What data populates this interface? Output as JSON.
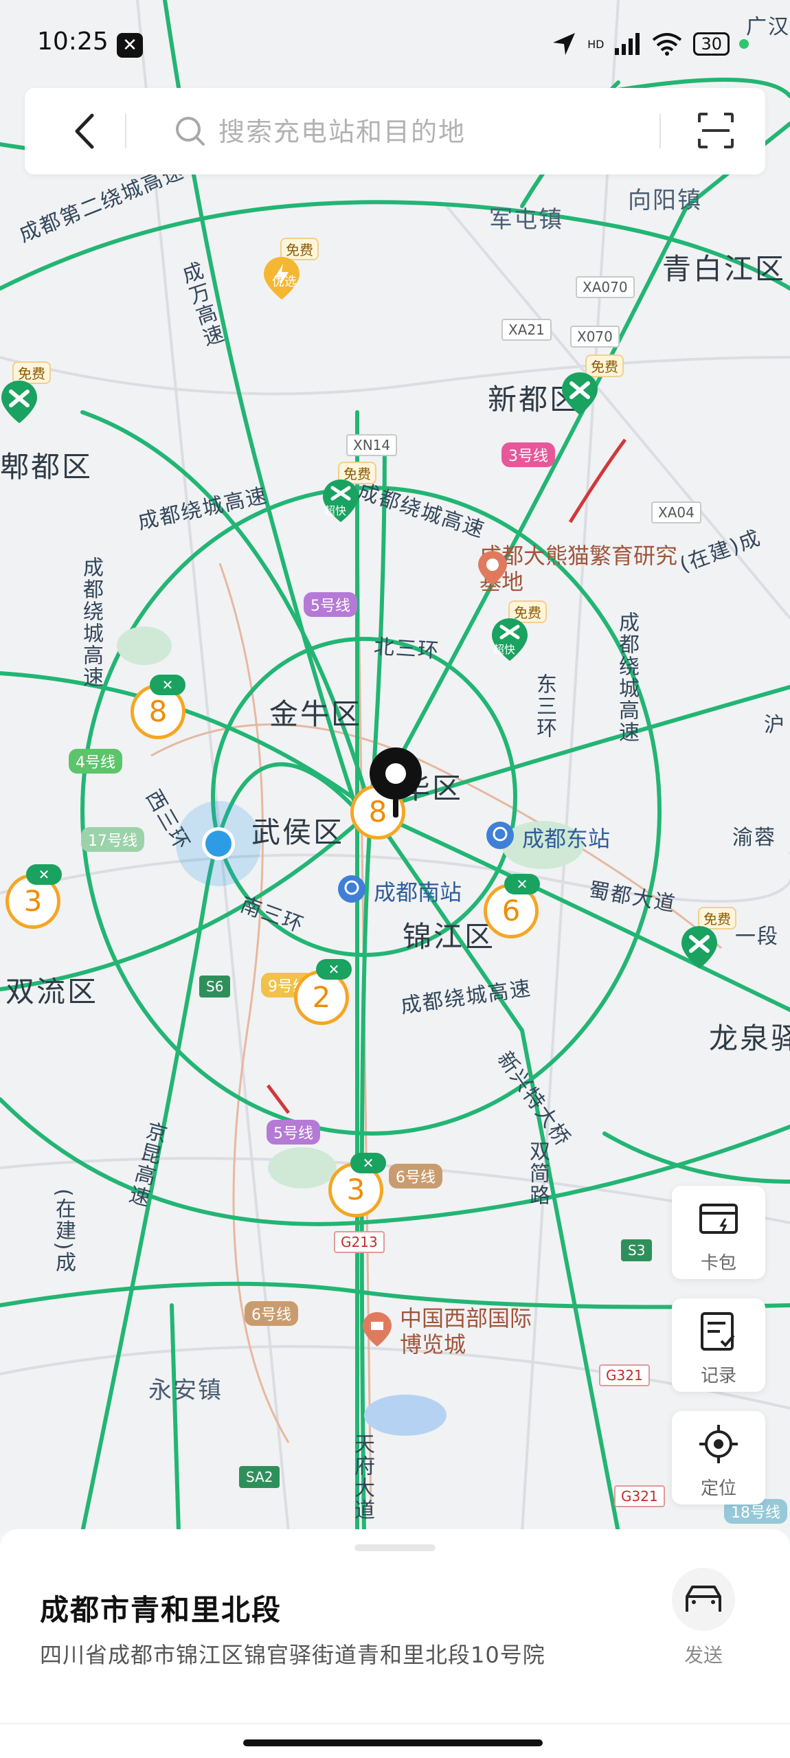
{
  "status_bar": {
    "time": "10:25",
    "app_icon_glyph": "✕",
    "signal_hd": "HD",
    "battery": "30"
  },
  "search": {
    "placeholder": "搜索充电站和目的地"
  },
  "map": {
    "districts": [
      {
        "id": "qingbaijiang",
        "text": "青白江区"
      },
      {
        "id": "xindu",
        "text": "新都区"
      },
      {
        "id": "jinniu",
        "text": "金牛区"
      },
      {
        "id": "wuhou",
        "text": "武侯区"
      },
      {
        "id": "jinjiang",
        "text": "锦江区"
      },
      {
        "id": "shuangliu",
        "text": "双流区"
      },
      {
        "id": "longquan",
        "text": "龙泉驿"
      },
      {
        "id": "pixian",
        "text": "郫都区"
      },
      {
        "id": "chenghua",
        "text": "华区"
      }
    ],
    "towns": [
      {
        "id": "juntun",
        "text": "军屯镇"
      },
      {
        "id": "xiangyang",
        "text": "向阳镇"
      },
      {
        "id": "yongan",
        "text": "永安镇"
      }
    ],
    "roads": [
      {
        "id": "r1",
        "text": "成都第二绕城高速"
      },
      {
        "id": "r2",
        "text": "成都绕城高速"
      },
      {
        "id": "r3",
        "text": "成都绕城高速"
      },
      {
        "id": "r4",
        "text": "成都绕城高速"
      },
      {
        "id": "r5",
        "text": "成都绕城高速"
      },
      {
        "id": "r6",
        "text": "北三环"
      },
      {
        "id": "r7",
        "text": "东三环"
      },
      {
        "id": "r8",
        "text": "南三环"
      },
      {
        "id": "r9",
        "text": "西三环"
      },
      {
        "id": "r10",
        "text": "成都绕城高速"
      },
      {
        "id": "r11",
        "text": "成都绕城高速"
      },
      {
        "id": "r12",
        "text": "蜀都大道"
      },
      {
        "id": "r13",
        "text": "新兴特大桥"
      },
      {
        "id": "r14",
        "text": "双简路"
      },
      {
        "id": "r15",
        "text": "京昆高速"
      },
      {
        "id": "r16",
        "text": "天府大道"
      },
      {
        "id": "r17",
        "text": "成万高速"
      },
      {
        "id": "r18",
        "text": "(在建)成"
      },
      {
        "id": "r19",
        "text": "(在建)成"
      },
      {
        "id": "r20",
        "text": "渝蓉"
      },
      {
        "id": "r21",
        "text": "一段"
      },
      {
        "id": "r22",
        "text": "广汉"
      },
      {
        "id": "r23",
        "text": "沪"
      }
    ],
    "pois": [
      {
        "id": "panda",
        "text": "成都大熊猫繁育研究基地"
      },
      {
        "id": "expo",
        "text": "中国西部国际博览城"
      }
    ],
    "stations": [
      {
        "id": "east",
        "text": "成都东站"
      },
      {
        "id": "south",
        "text": "成都南站"
      }
    ],
    "shields": [
      {
        "id": "xa070",
        "text": "XA070"
      },
      {
        "id": "xa21",
        "text": "XA21"
      },
      {
        "id": "x070",
        "text": "X070"
      },
      {
        "id": "xn14",
        "text": "XN14"
      },
      {
        "id": "xa04",
        "text": "XA04"
      },
      {
        "id": "s6",
        "text": "S6"
      },
      {
        "id": "s3",
        "text": "S3"
      },
      {
        "id": "g213",
        "text": "G213"
      },
      {
        "id": "g321a",
        "text": "G321"
      },
      {
        "id": "g321b",
        "text": "G321"
      },
      {
        "id": "sa2",
        "text": "SA2"
      }
    ],
    "metro_lines": [
      {
        "id": "m3",
        "text": "3号线"
      },
      {
        "id": "m5a",
        "text": "5号线"
      },
      {
        "id": "m4",
        "text": "4号线"
      },
      {
        "id": "m17",
        "text": "17号线"
      },
      {
        "id": "m9",
        "text": "9号线"
      },
      {
        "id": "m5b",
        "text": "5号线"
      },
      {
        "id": "m6a",
        "text": "6号线"
      },
      {
        "id": "m6b",
        "text": "6号线"
      },
      {
        "id": "m18",
        "text": "18号线"
      }
    ],
    "free_tag": "免费",
    "youxuan_tag": "优选",
    "chaokuai_tag": "超快",
    "clusters": [
      {
        "id": "c8a",
        "count": "8"
      },
      {
        "id": "c8b",
        "count": "8"
      },
      {
        "id": "c3a",
        "count": "3"
      },
      {
        "id": "c2",
        "count": "2"
      },
      {
        "id": "c6",
        "count": "6"
      },
      {
        "id": "c3b",
        "count": "3"
      }
    ]
  },
  "side_buttons": [
    {
      "id": "card",
      "label": "卡包"
    },
    {
      "id": "record",
      "label": "记录"
    },
    {
      "id": "locate",
      "label": "定位"
    }
  ],
  "sheet": {
    "title": "成都市青和里北段",
    "address": "四川省成都市锦江区锦官驿街道青和里北段10号院",
    "send_label": "发送"
  },
  "colors": {
    "road_green": "#22b573",
    "accent_orange": "#f5a623",
    "charger_green": "#1aa260",
    "location_blue": "#2e9be6"
  }
}
